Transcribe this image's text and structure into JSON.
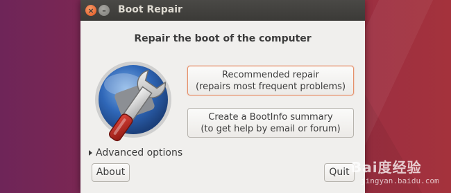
{
  "window": {
    "title": "Boot Repair",
    "close_glyph": "×",
    "minimize_glyph": "–"
  },
  "main": {
    "heading": "Repair the boot of the computer",
    "recommended": {
      "line1": "Recommended repair",
      "line2": "(repairs most frequent problems)"
    },
    "bootinfo": {
      "line1": "Create a BootInfo summary",
      "line2": "(to get help by email or forum)"
    },
    "advanced_label": "Advanced options",
    "about_label": "About",
    "quit_label": "Quit"
  },
  "icons": {
    "logo": "boot-repair-wrench-logo",
    "expander": "triangle-right-icon"
  },
  "colors": {
    "accent": "#e95420",
    "titlebar": "#3c3b37",
    "window_bg": "#f0efed"
  },
  "watermark": {
    "text": "Bai度经验",
    "url": "jingyan.baidu.com"
  }
}
